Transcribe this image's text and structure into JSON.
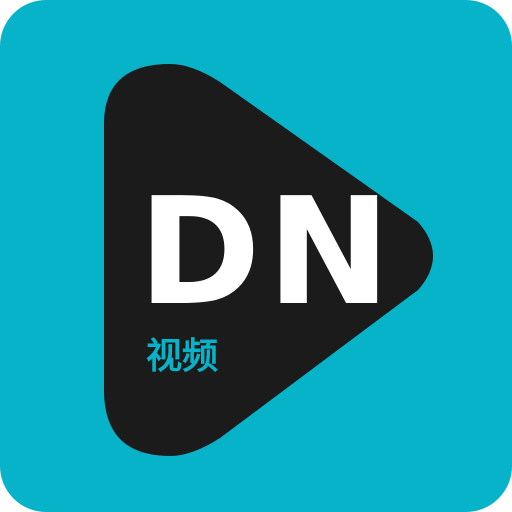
{
  "app_icon": {
    "logo_text": "DN",
    "logo_subtext": "视频",
    "background_color": "#06b3c8",
    "play_shape_color": "#1b1b1b",
    "logo_text_color": "#ffffff",
    "logo_subtext_color": "#06b3c8",
    "icon_name": "play-icon"
  }
}
